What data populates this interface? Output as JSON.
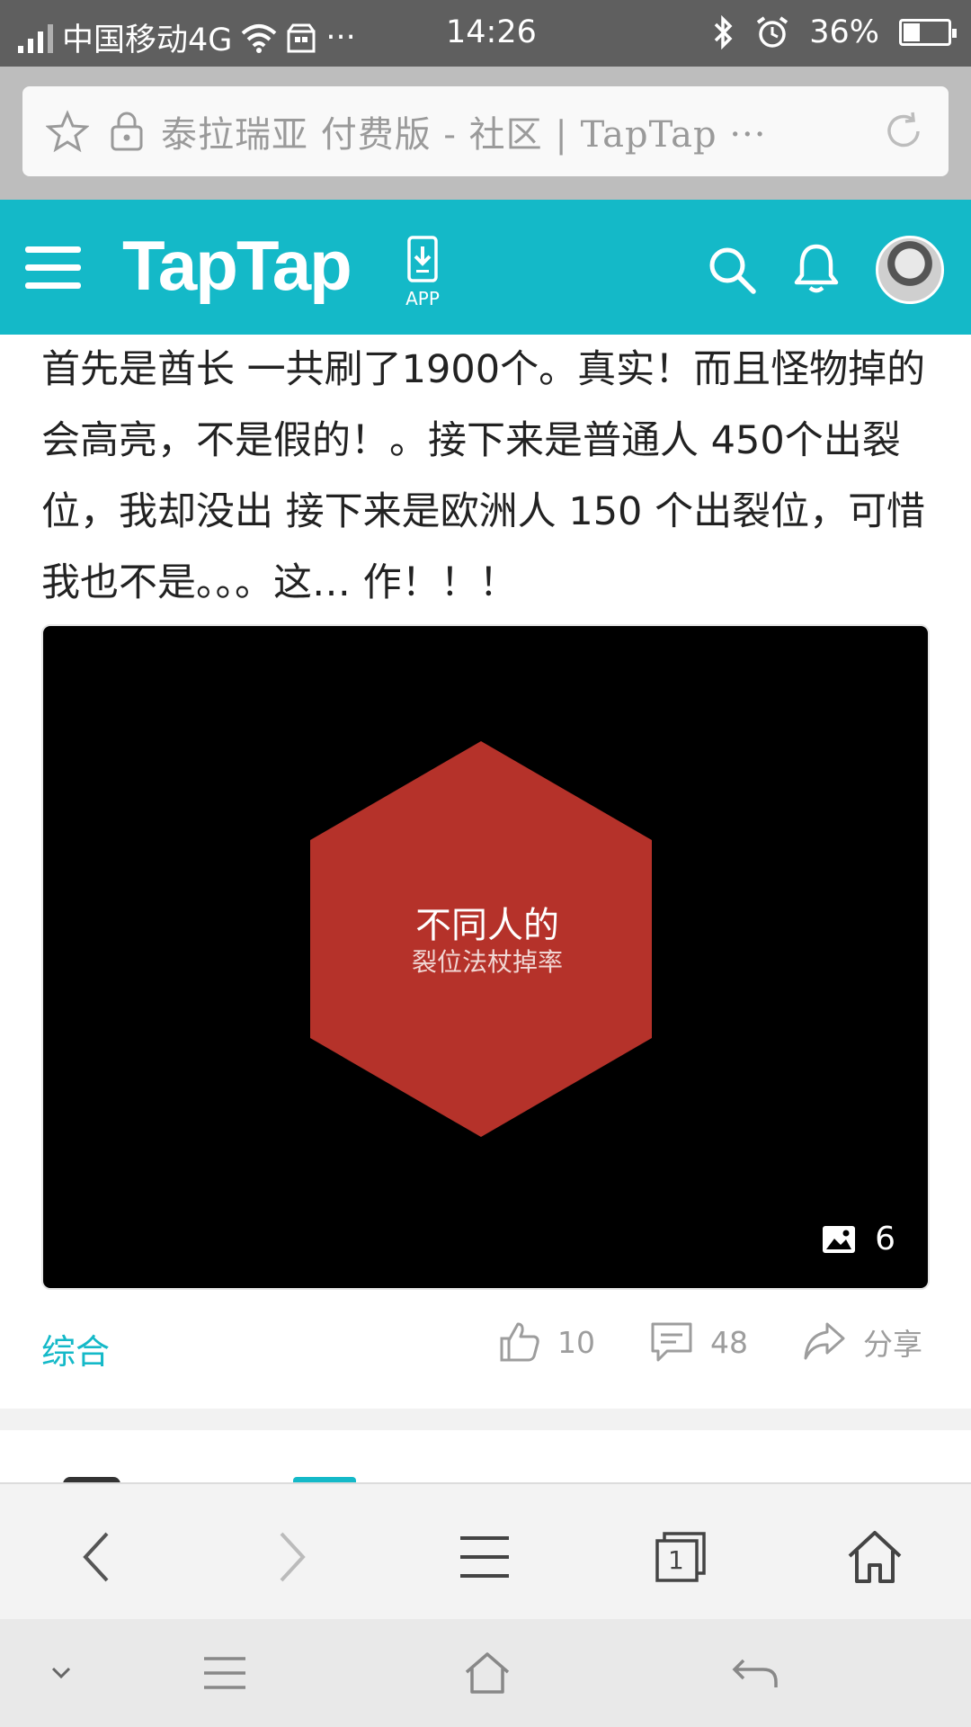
{
  "status_bar": {
    "carrier": "中国移动4G",
    "more": "···",
    "time": "14:26",
    "battery": "36%",
    "battery_level": 0.36
  },
  "address_bar": {
    "url_text": "泰拉瑞亚 付费版 - 社区 | TapTap ···"
  },
  "header": {
    "logo": "TapTap",
    "app_label": "APP",
    "brand_color": "#14b9c8"
  },
  "article": {
    "text": "首先是酋长 一共刷了1900个。真实！而且怪物掉的会高亮，不是假的！。接下来是普通人 450个出裂位，我却没出 接下来是欧洲人 150 个出裂位，可惜我也不是。。。这… 作！！！"
  },
  "media": {
    "caption_title": "不同人的",
    "caption_sub": "裂位法杖掉率",
    "image_count": "6",
    "hex_color": "#b5322a"
  },
  "actions": {
    "tag": "综合",
    "likes": "10",
    "comments": "48",
    "share": "分享"
  },
  "browser_nav": {
    "tab_count": "1"
  }
}
